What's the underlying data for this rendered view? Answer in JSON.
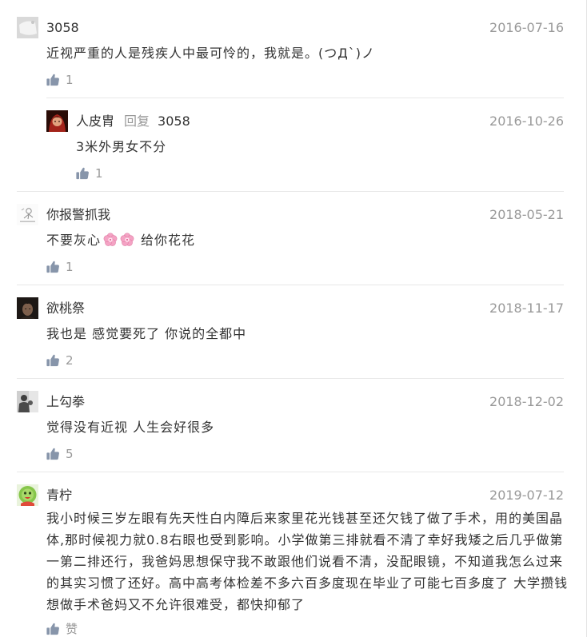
{
  "theme": {
    "text": "#333333",
    "muted": "#999999",
    "like_icon": "#8795aa",
    "divider": "#e8e8e8"
  },
  "comments": [
    {
      "user": {
        "name": "3058"
      },
      "date": "2016-07-16",
      "content": "近视严重的人是残疾人中最可怜的，我就是。(つД`)ノ",
      "like": {
        "icon": "thumbs-up-icon",
        "count": "1"
      },
      "replies": [
        {
          "user": {
            "name": "人皮胄"
          },
          "reply_label": "回复",
          "reply_to": "3058",
          "date": "2016-10-26",
          "content": "3米外男女不分",
          "like": {
            "icon": "thumbs-up-icon",
            "count": "1"
          }
        }
      ]
    },
    {
      "user": {
        "name": "你报警抓我"
      },
      "date": "2018-05-21",
      "content_segments": [
        {
          "text": "不要灰心"
        },
        {
          "emoji": "cherry-blossom-icon"
        },
        {
          "emoji": "cherry-blossom-icon"
        },
        {
          "text": "给你花花"
        }
      ],
      "like": {
        "icon": "thumbs-up-icon",
        "count": "1"
      }
    },
    {
      "user": {
        "name": "欲桃祭"
      },
      "date": "2018-11-17",
      "content": "我也是 感觉要死了 你说的全都中",
      "like": {
        "icon": "thumbs-up-icon",
        "count": "2"
      }
    },
    {
      "user": {
        "name": "上勾拳"
      },
      "date": "2018-12-02",
      "content": "觉得没有近视 人生会好很多",
      "like": {
        "icon": "thumbs-up-icon",
        "count": "5"
      }
    },
    {
      "user": {
        "name": "青柠"
      },
      "date": "2019-07-12",
      "content": "我小时候三岁左眼有先天性白内障后来家里花光钱甚至还欠钱了做了手术，用的美国晶体,那时候视力就0.8右眼也受到影响。小学做第三排就看不清了幸好我矮之后几乎做第一第二排还行，我爸妈思想保守我不敢跟他们说看不清，没配眼镜，不知道我怎么过来的其实习惯了还好。高中高考体检差不多六百多度现在毕业了可能七百多度了 大学攒钱想做手术爸妈又不允许很难受，都快抑郁了",
      "like": {
        "icon": "thumbs-up-icon",
        "label": "赞"
      }
    }
  ]
}
